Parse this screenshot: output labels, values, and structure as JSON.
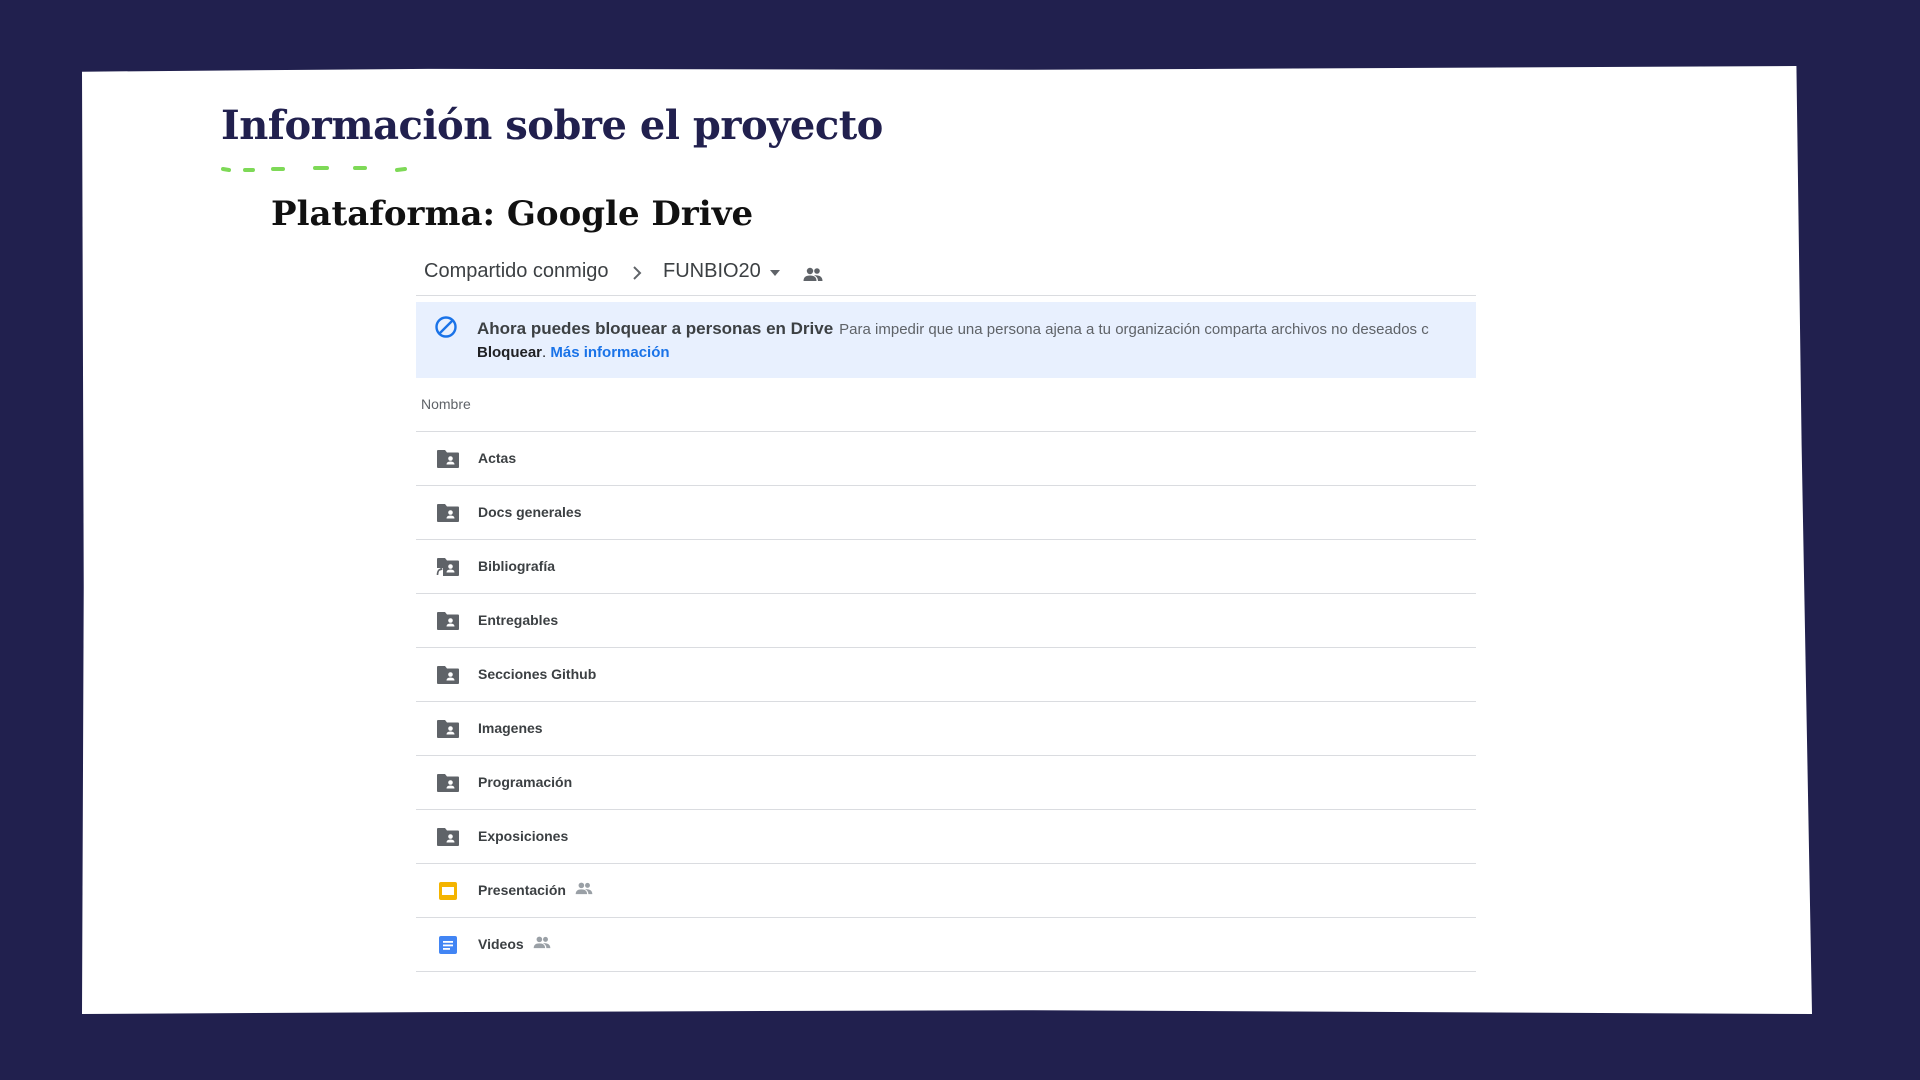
{
  "slide": {
    "title": "Información sobre el proyecto",
    "subtitle": "Plataforma: Google Drive",
    "accent_color": "#7ed957",
    "background_color": "#21204e"
  },
  "drive": {
    "breadcrumb": {
      "parent": "Compartido conmigo",
      "separator_icon": "chevron-right-icon",
      "current": "FUNBIO20",
      "dropdown_icon": "caret-down-icon",
      "shared_icon": "people-icon"
    },
    "banner": {
      "icon": "block-icon",
      "title": "Ahora puedes bloquear a personas en Drive",
      "description": "Para impedir que una persona ajena a tu organización comparta archivos no deseados c",
      "action_word": "Bloquear",
      "punct": ".",
      "link": "Más información"
    },
    "columns": {
      "name": "Nombre"
    },
    "files": [
      {
        "name": "Actas",
        "icon": "shared-folder-icon",
        "shared": false
      },
      {
        "name": "Docs generales",
        "icon": "shared-folder-icon",
        "shared": false
      },
      {
        "name": "Bibliografía",
        "icon": "shared-folder-shortcut-icon",
        "shared": false
      },
      {
        "name": "Entregables",
        "icon": "shared-folder-icon",
        "shared": false
      },
      {
        "name": "Secciones Github",
        "icon": "shared-folder-icon",
        "shared": false
      },
      {
        "name": "Imagenes",
        "icon": "shared-folder-icon",
        "shared": false
      },
      {
        "name": "Programación",
        "icon": "shared-folder-icon",
        "shared": false
      },
      {
        "name": "Exposiciones",
        "icon": "shared-folder-icon",
        "shared": false
      },
      {
        "name": "Presentación",
        "icon": "slides-icon",
        "shared": true
      },
      {
        "name": "Videos",
        "icon": "docs-icon",
        "shared": true
      }
    ]
  }
}
